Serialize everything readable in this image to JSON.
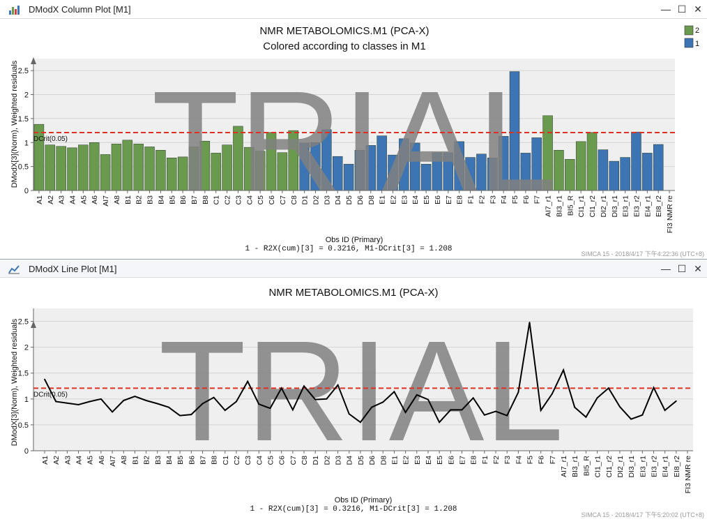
{
  "window1": {
    "title": "DModX Column Plot [M1]",
    "controls": {
      "minimize": "—",
      "maximize": "☐",
      "close": "✕"
    },
    "icon": "bar-chart-icon"
  },
  "window2": {
    "title": "DModX Line Plot [M1]",
    "controls": {
      "minimize": "—",
      "maximize": "☐",
      "close": "✕"
    },
    "icon": "line-chart-icon"
  },
  "colors": {
    "class2": "#6a9a4e",
    "class1": "#3c74b4",
    "crit": "#e03020",
    "line": "#000000",
    "watermark": "#808080"
  },
  "chart_data": [
    {
      "type": "bar",
      "title": "NMR METABOLOMICS.M1 (PCA-X)",
      "subtitle": "Colored according to classes in M1",
      "xlabel": "Obs ID (Primary)",
      "ylabel": "DModX[3](Norm), Weighted residuals",
      "footer": "1 - R2X(cum)[3] = 0.3216, M1-DCrit[3] = 1.208",
      "timestamp": "SIMCA 15 - 2018/4/17 下午4:22:36 (UTC+8)",
      "watermark": "TRIAL",
      "crit_label": "DCrit(0.05)",
      "crit_value": 1.208,
      "ylim": [
        0,
        2.75
      ],
      "yticks": [
        "0",
        "0.5",
        "1",
        "1.5",
        "2",
        "2.5"
      ],
      "grid": true,
      "legend": [
        {
          "label": "2",
          "cls": "2"
        },
        {
          "label": "1",
          "cls": "1"
        }
      ],
      "legend_position": "top-right",
      "categories": [
        "A1",
        "A2",
        "A3",
        "A4",
        "A5",
        "A6",
        "AI7",
        "A8",
        "B1",
        "B2",
        "B3",
        "B4",
        "B5",
        "B6",
        "B7",
        "B8",
        "C1",
        "C2",
        "C3",
        "C4",
        "C5",
        "C6",
        "C7",
        "C8",
        "D1",
        "D2",
        "D3",
        "D4",
        "D5",
        "D6",
        "D8",
        "E1",
        "E2",
        "E3",
        "E4",
        "E5",
        "E6",
        "E7",
        "E8",
        "F1",
        "F2",
        "F3",
        "F4",
        "F5",
        "F6",
        "F7",
        "AI7_r1",
        "BI3_r1",
        "BI5_R",
        "CI1_r1",
        "CI1_r2",
        "DI2_r1",
        "DI3_r1",
        "EI3_r1",
        "EI3_r2",
        "EI4_r1",
        "EI8_r2",
        "FI3 NMR re"
      ],
      "values": [
        1.38,
        0.95,
        0.92,
        0.89,
        0.95,
        1.0,
        0.75,
        0.97,
        1.05,
        0.97,
        0.91,
        0.84,
        0.68,
        0.7,
        0.91,
        1.03,
        0.78,
        0.95,
        1.34,
        0.9,
        0.82,
        1.21,
        0.79,
        1.25,
        0.99,
        1.0,
        1.27,
        0.71,
        0.55,
        0.84,
        0.94,
        1.14,
        0.74,
        1.08,
        0.99,
        0.55,
        0.79,
        0.79,
        1.02,
        0.69,
        0.76,
        0.68,
        1.13,
        2.48,
        0.78,
        1.1,
        1.56,
        0.84,
        0.65,
        1.02,
        1.21,
        0.85,
        0.61,
        0.69,
        1.22,
        0.78,
        0.96
      ],
      "classes": [
        2,
        2,
        2,
        2,
        2,
        2,
        2,
        2,
        2,
        2,
        2,
        2,
        2,
        2,
        2,
        2,
        2,
        2,
        2,
        2,
        2,
        2,
        2,
        2,
        1,
        1,
        1,
        1,
        1,
        1,
        1,
        1,
        1,
        1,
        1,
        1,
        1,
        1,
        1,
        1,
        1,
        1,
        1,
        1,
        1,
        1,
        2,
        2,
        2,
        2,
        2,
        1,
        1,
        1,
        1,
        1,
        1,
        1
      ]
    },
    {
      "type": "line",
      "title": "NMR METABOLOMICS.M1 (PCA-X)",
      "xlabel": "Obs ID (Primary)",
      "ylabel": "DModX[3](Norm), Weighted residuals",
      "footer": "1 - R2X(cum)[3] = 0.3216, M1-DCrit[3] = 1.208",
      "timestamp": "SIMCA 15 - 2018/4/17 下午5:20:02 (UTC+8)",
      "watermark": "TRIAL",
      "crit_label": "DCrit(0.05)",
      "crit_value": 1.208,
      "ylim": [
        0,
        2.75
      ],
      "yticks": [
        "0",
        "0.5",
        "1",
        "1.5",
        "2",
        "2.5"
      ],
      "grid": true,
      "categories": [
        "A1",
        "A2",
        "A3",
        "A4",
        "A5",
        "A6",
        "AI7",
        "A8",
        "B1",
        "B2",
        "B3",
        "B4",
        "B5",
        "B6",
        "B7",
        "B8",
        "C1",
        "C2",
        "C3",
        "C4",
        "C5",
        "C6",
        "C7",
        "C8",
        "D1",
        "D2",
        "D3",
        "D4",
        "D5",
        "D6",
        "D8",
        "E1",
        "E2",
        "E3",
        "E4",
        "E5",
        "E6",
        "E7",
        "E8",
        "F1",
        "F2",
        "F3",
        "F4",
        "F5",
        "F6",
        "F7",
        "AI7_r1",
        "BI3_r1",
        "BI5_R",
        "CI1_r1",
        "CI1_r2",
        "DI2_r1",
        "DI3_r1",
        "EI3_r1",
        "EI3_r2",
        "EI4_r1",
        "EI8_r2",
        "FI3 NMR re"
      ],
      "values": [
        1.38,
        0.95,
        0.92,
        0.89,
        0.95,
        1.0,
        0.75,
        0.97,
        1.05,
        0.97,
        0.91,
        0.84,
        0.68,
        0.7,
        0.91,
        1.03,
        0.78,
        0.95,
        1.34,
        0.9,
        0.82,
        1.21,
        0.79,
        1.25,
        0.99,
        1.0,
        1.27,
        0.71,
        0.55,
        0.84,
        0.94,
        1.14,
        0.74,
        1.08,
        0.99,
        0.55,
        0.79,
        0.79,
        1.02,
        0.69,
        0.76,
        0.68,
        1.13,
        2.48,
        0.78,
        1.1,
        1.56,
        0.84,
        0.65,
        1.02,
        1.21,
        0.85,
        0.61,
        0.69,
        1.22,
        0.78,
        0.96
      ]
    }
  ]
}
